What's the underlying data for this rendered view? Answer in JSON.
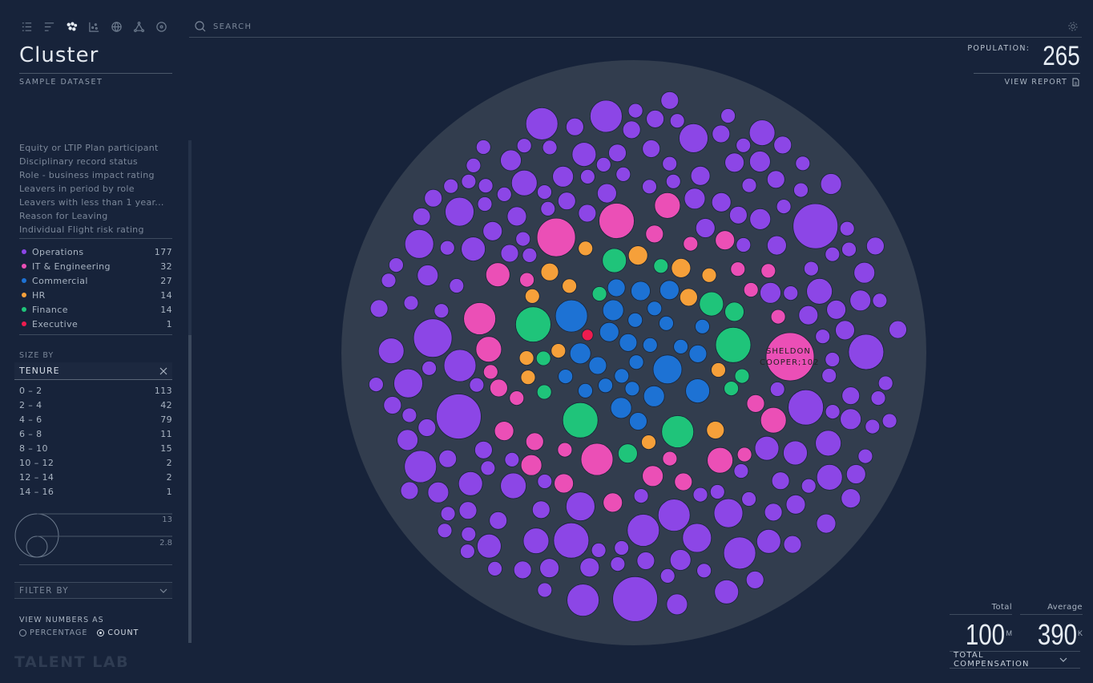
{
  "sidebar": {
    "title": "Cluster",
    "dataset": "SAMPLE DATASET",
    "view_icons": [
      "list-icon",
      "bar-chart-icon",
      "cluster-icon",
      "scatter-icon",
      "globe-icon",
      "network-icon",
      "target-icon"
    ],
    "attributes": [
      "Equity or LTIP Plan participant",
      "Disciplinary record status",
      "Role - business impact rating",
      "Leavers in period by role",
      "Leavers with less than 1 year...",
      "Reason for Leaving",
      "Individual Flight risk rating"
    ],
    "legend": [
      {
        "name": "Operations",
        "count": "177",
        "color": "#8c46e6"
      },
      {
        "name": "IT & Engineering",
        "count": "32",
        "color": "#eb4fb6"
      },
      {
        "name": "Commercial",
        "count": "27",
        "color": "#1d72d4"
      },
      {
        "name": "HR",
        "count": "14",
        "color": "#f6a03a"
      },
      {
        "name": "Finance",
        "count": "14",
        "color": "#1fc47a"
      },
      {
        "name": "Executive",
        "count": "1",
        "color": "#ee1c4f"
      }
    ],
    "size_by": {
      "label": "SIZE BY",
      "value": "TENURE",
      "ranges": [
        {
          "range": "0 – 2",
          "count": "113"
        },
        {
          "range": "2 – 4",
          "count": "42"
        },
        {
          "range": "4 – 6",
          "count": "79"
        },
        {
          "range": "6 – 8",
          "count": "11"
        },
        {
          "range": "8 – 10",
          "count": "15"
        },
        {
          "range": "10 – 12",
          "count": "2"
        },
        {
          "range": "12 – 14",
          "count": "2"
        },
        {
          "range": "14 – 16",
          "count": "1"
        }
      ],
      "size_max": "13",
      "size_min": "2.8"
    },
    "filter_by": "FILTER BY",
    "view_numbers": {
      "label": "VIEW NUMBERS AS",
      "options": [
        "PERCENTAGE",
        "COUNT"
      ],
      "selected": "COUNT"
    },
    "brand": "TALENT LAB"
  },
  "search": {
    "placeholder": "SEARCH"
  },
  "population": {
    "label": "POPULATION:",
    "value": "265"
  },
  "view_report": "VIEW REPORT",
  "chart_data": {
    "type": "bubble-cluster",
    "highlight": {
      "label_line1": "SHELDON",
      "label_line2": "COOPER;102"
    }
  },
  "stats": {
    "total": {
      "label": "Total",
      "value": "100",
      "unit": "M"
    },
    "average": {
      "label": "Average",
      "value": "390",
      "unit": "K"
    },
    "metric": "TOTAL COMPENSATION"
  }
}
